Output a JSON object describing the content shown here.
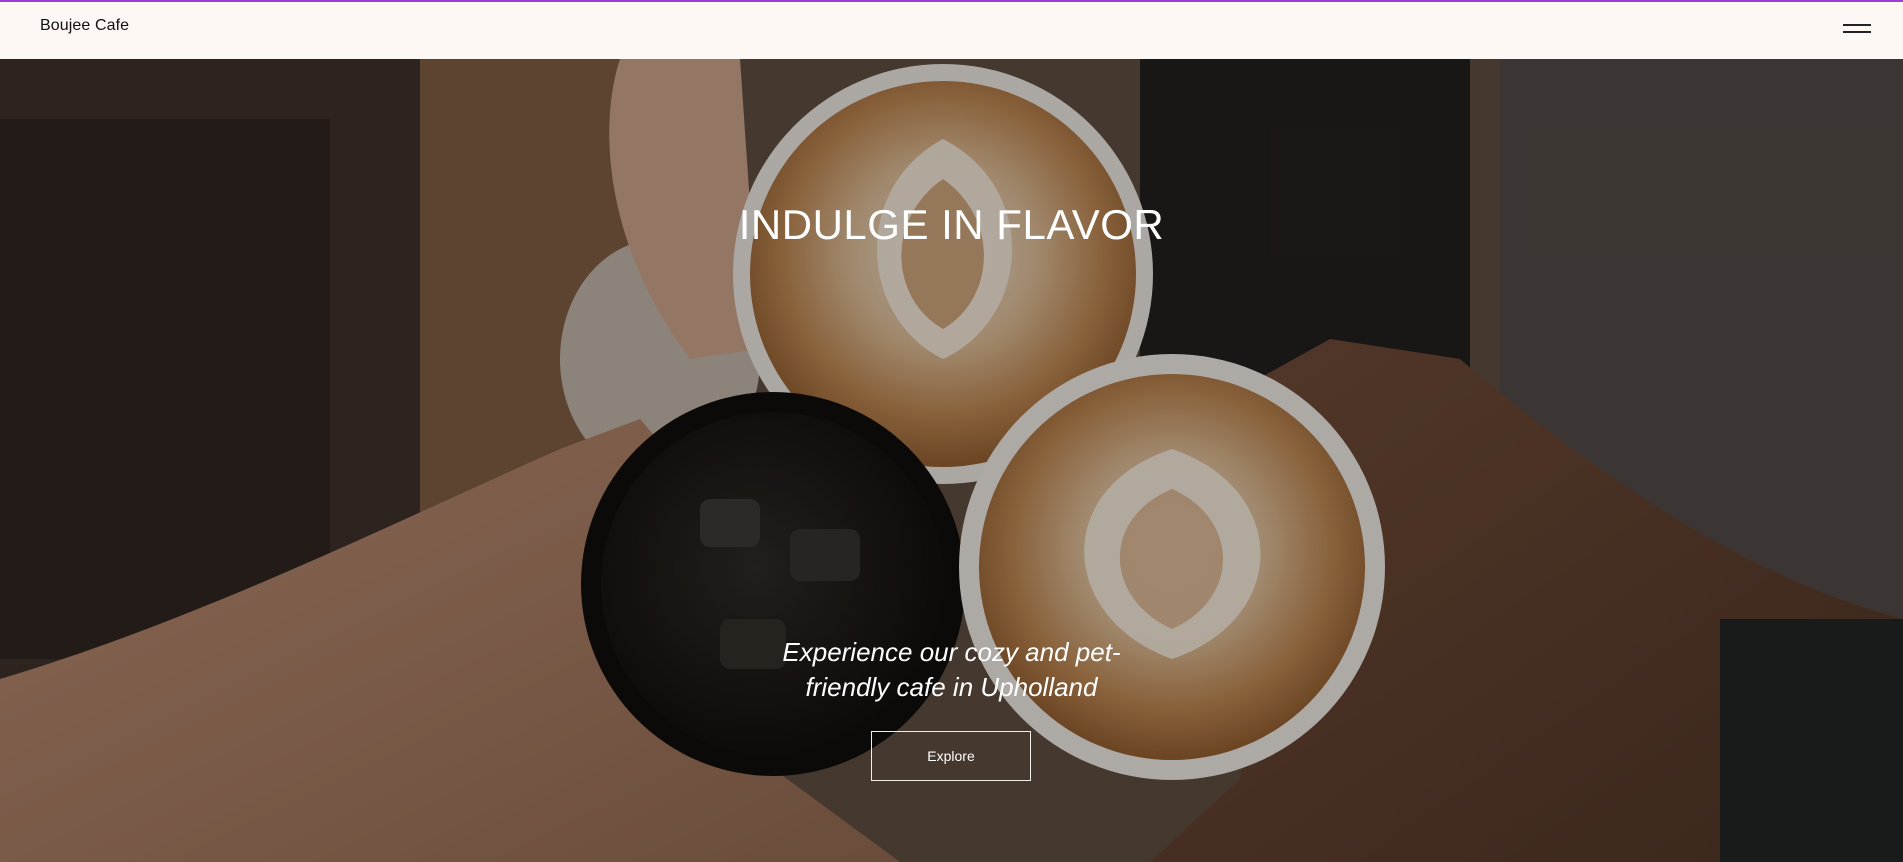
{
  "header": {
    "brand": "Boujee Cafe",
    "menu_icon": "hamburger-menu-icon"
  },
  "hero": {
    "title": "INDULGE IN FLAVOR",
    "subtitle": "Experience our cozy and pet-friendly cafe in Upholland",
    "cta_label": "Explore",
    "image_subject": "three hands toasting cups: two latte art cappuccinos and an iced black coffee"
  },
  "colors": {
    "header_bg": "#fdf8f3",
    "accent_line": "#9b3fd6",
    "hero_text": "#ffffff",
    "button_border": "#f3eee8"
  }
}
